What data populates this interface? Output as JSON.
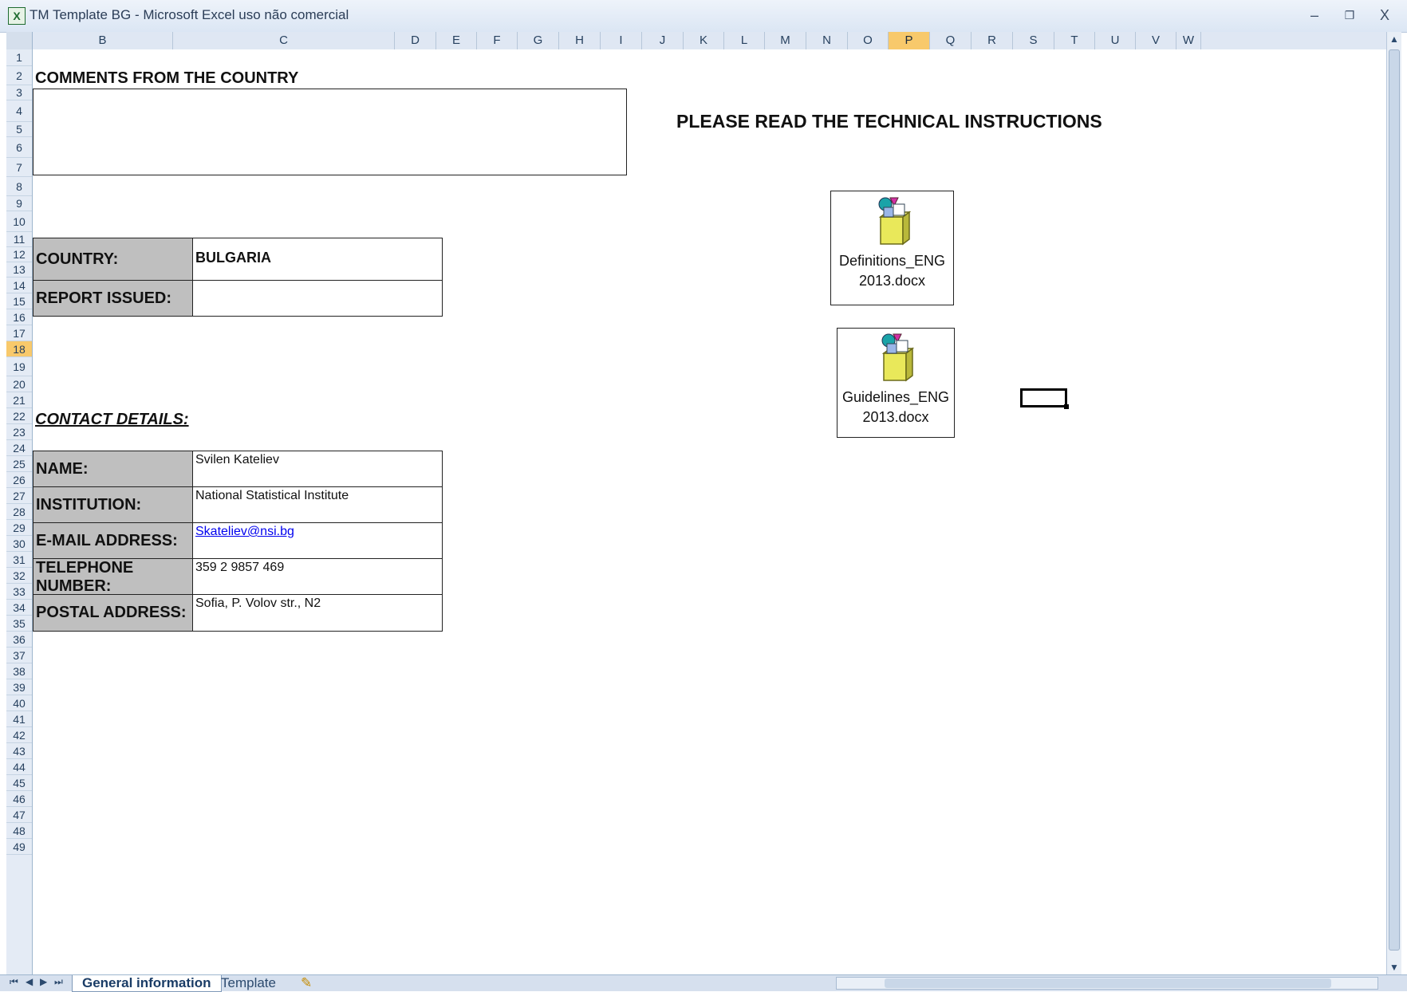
{
  "window": {
    "title": "TM Template BG - Microsoft Excel uso não comercial",
    "app_icon": "X",
    "minimize": "‒",
    "restore": "❐",
    "close": "X"
  },
  "columns": [
    "B",
    "C",
    "D",
    "E",
    "F",
    "G",
    "H",
    "I",
    "J",
    "K",
    "L",
    "M",
    "N",
    "O",
    "P",
    "Q",
    "R",
    "S",
    "T",
    "U",
    "V",
    "W"
  ],
  "selected_column": "P",
  "rows": [
    "1",
    "2",
    "3",
    "4",
    "5",
    "6",
    "7",
    "8",
    "9",
    "10",
    "11",
    "12",
    "13",
    "14",
    "15",
    "16",
    "17",
    "18",
    "19",
    "20",
    "21",
    "22",
    "23",
    "24",
    "25",
    "26",
    "27",
    "28",
    "29",
    "30",
    "31",
    "32",
    "33",
    "34",
    "35",
    "36",
    "37",
    "38",
    "39",
    "40",
    "41",
    "42",
    "43",
    "44",
    "45",
    "46",
    "47",
    "48",
    "49"
  ],
  "selected_row": "18",
  "sheet": {
    "comments_heading": "COMMENTS FROM THE COUNTRY",
    "instructions_heading": "PLEASE READ THE TECHNICAL INSTRUCTIONS",
    "country_label": "COUNTRY:",
    "country_value": "BULGARIA",
    "report_label": "REPORT ISSUED:",
    "report_value": "",
    "contact_heading": "CONTACT DETAILS:",
    "contacts": [
      {
        "label": "NAME:",
        "value": "Svilen Kateliev"
      },
      {
        "label": "INSTITUTION:",
        "value": "National Statistical Institute"
      },
      {
        "label": "E-MAIL ADDRESS:",
        "value": "Skateliev@nsi.bg"
      },
      {
        "label": "TELEPHONE NUMBER:",
        "value": "359 2 9857 469"
      },
      {
        "label": "POSTAL ADDRESS:",
        "value": "Sofia, P. Volov str., N2"
      }
    ],
    "embedded_objects": [
      {
        "line1": "Definitions_ENG",
        "line2": "2013.docx",
        "icon": "package-icon"
      },
      {
        "line1": "Guidelines_ENG",
        "line2": "2013.docx",
        "icon": "package-icon"
      }
    ]
  },
  "tabs": {
    "nav": [
      "⏮",
      "◀",
      "▶",
      "⏭"
    ],
    "general": "General information",
    "template": "Template",
    "new_sheet_icon": "insert-sheet-icon"
  },
  "colors": {
    "label_fill": "#bfbfbf",
    "selection_header": "#f8c96b",
    "link": "#0000ee"
  }
}
